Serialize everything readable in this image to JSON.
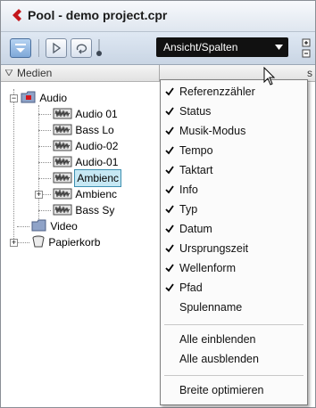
{
  "window": {
    "title": "Pool - demo project.cpr"
  },
  "toolbar": {
    "view_button_label": "Ansicht/Spalten",
    "buttons": [
      "view-toggle-icon",
      "play-icon",
      "loop-icon"
    ]
  },
  "column_header": {
    "label": "Medien",
    "clipped_next": "s"
  },
  "tree": {
    "items": [
      {
        "label": "Audio",
        "icon": "audio-folder-icon"
      },
      {
        "label": "Audio 01",
        "icon": "audio-file-icon"
      },
      {
        "label": "Bass Lo",
        "icon": "audio-file-icon"
      },
      {
        "label": "Audio-02",
        "icon": "audio-file-icon"
      },
      {
        "label": "Audio-01",
        "icon": "audio-file-icon"
      },
      {
        "label": "Ambienc",
        "icon": "audio-file-icon",
        "selected": true
      },
      {
        "label": "Ambienc",
        "icon": "audio-file-icon"
      },
      {
        "label": "Bass Sy",
        "icon": "audio-file-icon"
      },
      {
        "label": "Video",
        "icon": "video-folder-icon"
      },
      {
        "label": "Papierkorb",
        "icon": "trash-icon"
      }
    ]
  },
  "menu": {
    "items": [
      {
        "label": "Referenzzähler",
        "checked": true
      },
      {
        "label": "Status",
        "checked": true
      },
      {
        "label": "Musik-Modus",
        "checked": true
      },
      {
        "label": "Tempo",
        "checked": true
      },
      {
        "label": "Taktart",
        "checked": true
      },
      {
        "label": "Info",
        "checked": true
      },
      {
        "label": "Typ",
        "checked": true
      },
      {
        "label": "Datum",
        "checked": true
      },
      {
        "label": "Ursprungszeit",
        "checked": true
      },
      {
        "label": "Wellenform",
        "checked": true
      },
      {
        "label": "Pfad",
        "checked": true
      },
      {
        "label": "Spulenname",
        "checked": false
      },
      {
        "label": "Alle einblenden",
        "checked": false
      },
      {
        "label": "Alle ausblenden",
        "checked": false
      },
      {
        "label": "Breite optimieren",
        "checked": false
      }
    ]
  }
}
